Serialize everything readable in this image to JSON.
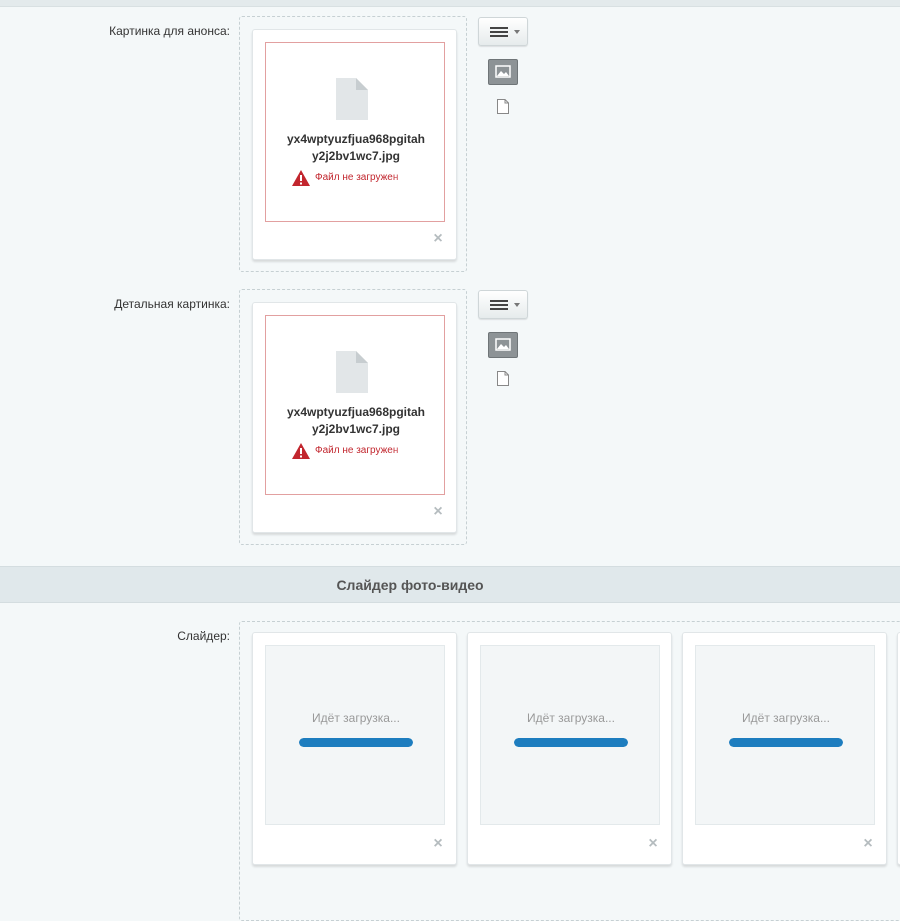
{
  "preview_field": {
    "label": "Картинка для анонса:",
    "file_name_line1": "yx4wptyuzfjua968pgitah",
    "file_name_line2": "y2j2bv1wc7.jpg",
    "error": "Файл не загружен"
  },
  "detail_field": {
    "label": "Детальная картинка:",
    "file_name_line1": "yx4wptyuzfjua968pgitah",
    "file_name_line2": "y2j2bv1wc7.jpg",
    "error": "Файл не загружен"
  },
  "section": {
    "title": "Слайдер фото-видео"
  },
  "slider_field": {
    "label": "Слайдер:",
    "items": [
      {
        "status": "Идёт загрузка...",
        "progress": 1.0
      },
      {
        "status": "Идёт загрузка...",
        "progress": 1.0
      },
      {
        "status": "Идёт загрузка...",
        "progress": 1.0
      }
    ]
  },
  "icons": {
    "file": "file-icon",
    "warning": "warning-icon",
    "close": "close-icon",
    "menu": "menu-icon",
    "image": "image-icon",
    "document": "document-icon"
  },
  "colors": {
    "error": "#c2262e",
    "progress": "#1d7dbf",
    "background": "#f4f8f9"
  }
}
